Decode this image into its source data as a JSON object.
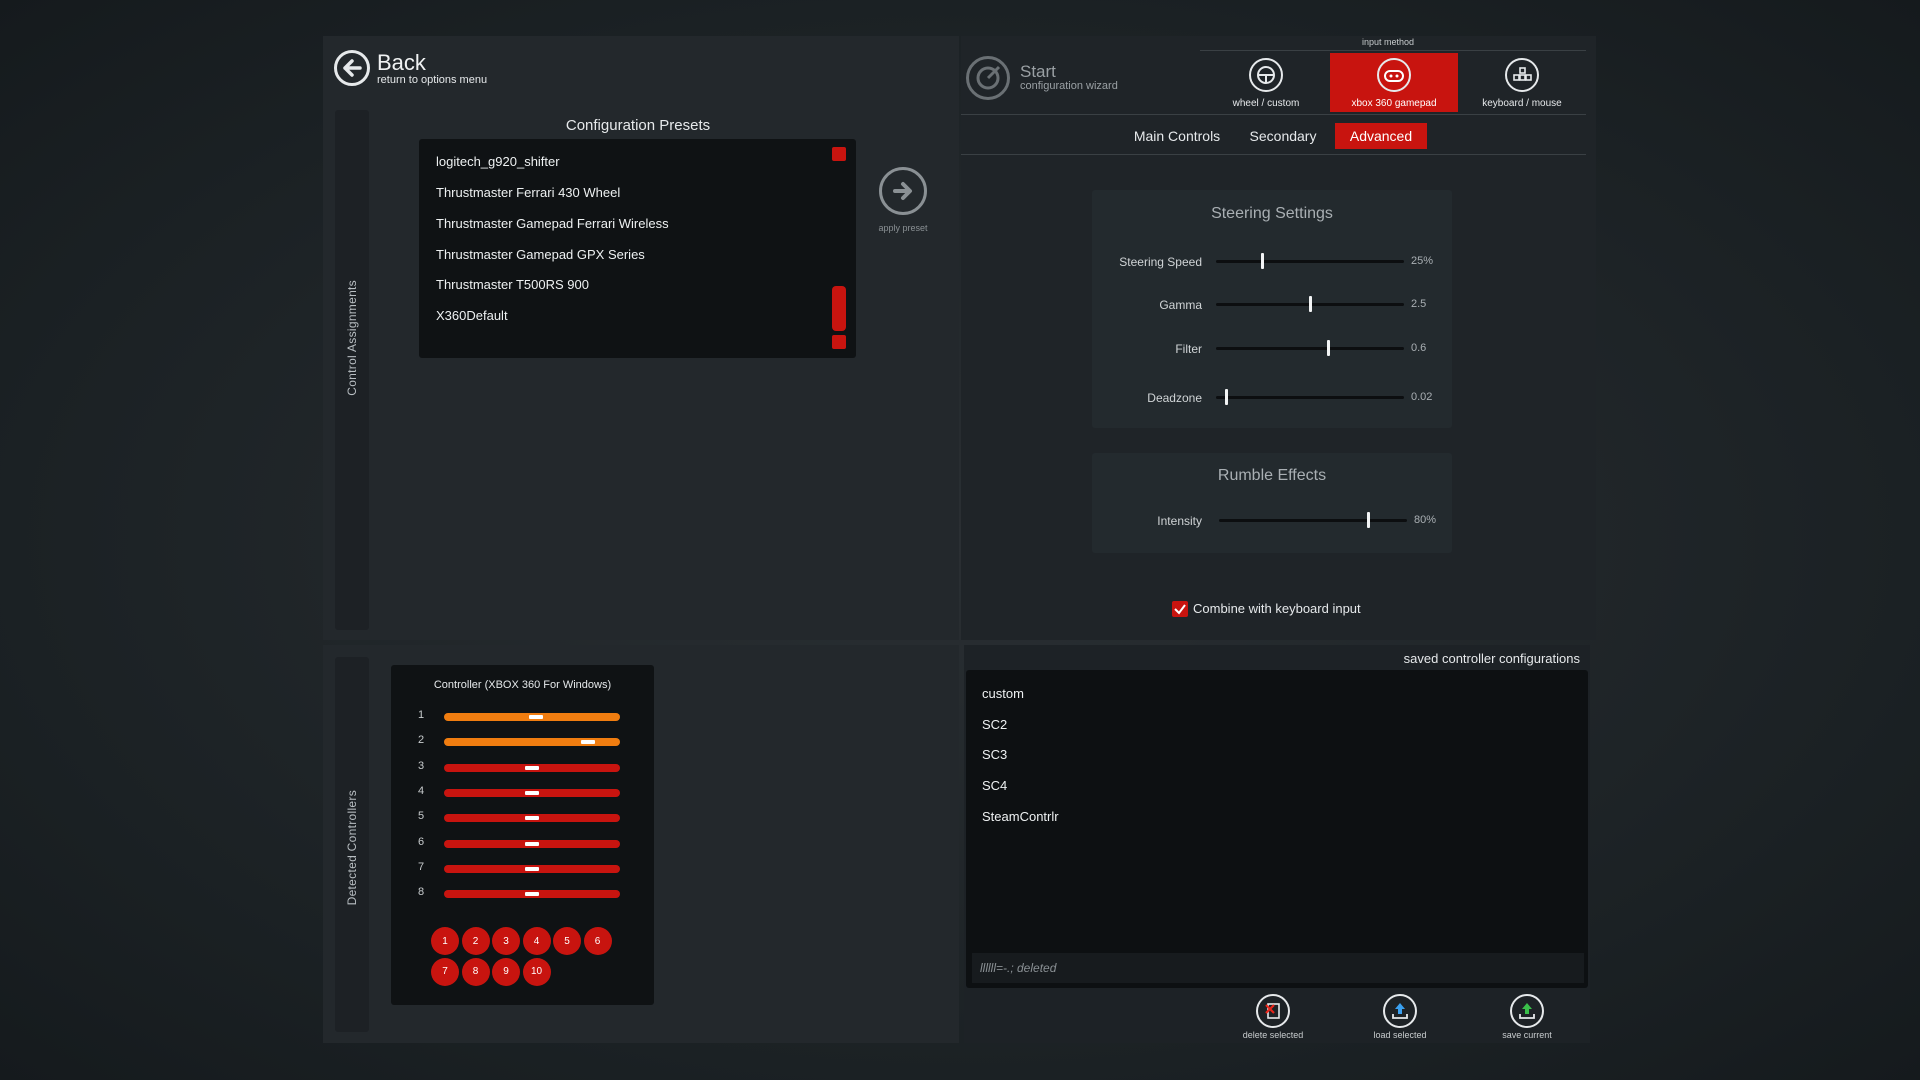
{
  "back": {
    "label": "Back",
    "sublabel": "return to options menu"
  },
  "start": {
    "label": "Start",
    "sublabel": "configuration wizard"
  },
  "input_method": {
    "title": "input method",
    "options": [
      {
        "label": "wheel / custom",
        "icon": "steering-wheel-icon",
        "selected": false
      },
      {
        "label": "xbox 360 gamepad",
        "icon": "gamepad-icon",
        "selected": true
      },
      {
        "label": "keyboard / mouse",
        "icon": "keyboard-icon",
        "selected": false
      }
    ]
  },
  "tabs": [
    {
      "label": "Main Controls",
      "active": false
    },
    {
      "label": "Secondary",
      "active": false
    },
    {
      "label": "Advanced",
      "active": true
    }
  ],
  "sidebar_top": "Control Assignments",
  "sidebar_bottom": "Detected Controllers",
  "presets": {
    "title": "Configuration Presets",
    "items": [
      "logitech_g920_shifter",
      "Thrustmaster Ferrari 430 Wheel",
      "Thrustmaster Gamepad Ferrari Wireless",
      "Thrustmaster Gamepad GPX Series",
      "Thrustmaster T500RS 900",
      "X360Default"
    ],
    "apply_label": "apply preset"
  },
  "steering": {
    "title": "Steering Settings",
    "sliders": [
      {
        "label": "Steering Speed",
        "value": "25%",
        "fraction": 0.25
      },
      {
        "label": "Gamma",
        "value": "2.5",
        "fraction": 0.5
      },
      {
        "label": "Filter",
        "value": "0.6",
        "fraction": 0.6
      },
      {
        "label": "Deadzone",
        "value": "0.02",
        "fraction": 0.05
      }
    ]
  },
  "rumble": {
    "title": "Rumble Effects",
    "sliders": [
      {
        "label": "Intensity",
        "value": "80%",
        "fraction": 0.8
      }
    ]
  },
  "combine": {
    "label": "Combine with keyboard input",
    "checked": true
  },
  "controller": {
    "title": "Controller (XBOX 360 For Windows)",
    "axes": [
      {
        "n": "1",
        "pos": 0.52,
        "color": "#f07d10"
      },
      {
        "n": "2",
        "pos": 0.82,
        "color": "#f07d10"
      },
      {
        "n": "3",
        "pos": 0.5,
        "color": "#c8140f"
      },
      {
        "n": "4",
        "pos": 0.5,
        "color": "#c8140f"
      },
      {
        "n": "5",
        "pos": 0.5,
        "color": "#c8140f"
      },
      {
        "n": "6",
        "pos": 0.5,
        "color": "#c8140f"
      },
      {
        "n": "7",
        "pos": 0.5,
        "color": "#c8140f"
      },
      {
        "n": "8",
        "pos": 0.5,
        "color": "#c8140f"
      }
    ],
    "buttons": [
      "1",
      "2",
      "3",
      "4",
      "5",
      "6",
      "7",
      "8",
      "9",
      "10"
    ]
  },
  "saved": {
    "title": "saved controller configurations",
    "items": [
      "custom",
      "SC2",
      "SC3",
      "SC4",
      "SteamContrlr"
    ],
    "name_field": "llllll=-.; deleted",
    "actions": [
      {
        "label": "delete selected",
        "icon": "delete-icon"
      },
      {
        "label": "load selected",
        "icon": "load-icon"
      },
      {
        "label": "save current",
        "icon": "save-icon"
      }
    ]
  },
  "colors": {
    "accent": "#c8140f",
    "orange": "#f07d10"
  }
}
